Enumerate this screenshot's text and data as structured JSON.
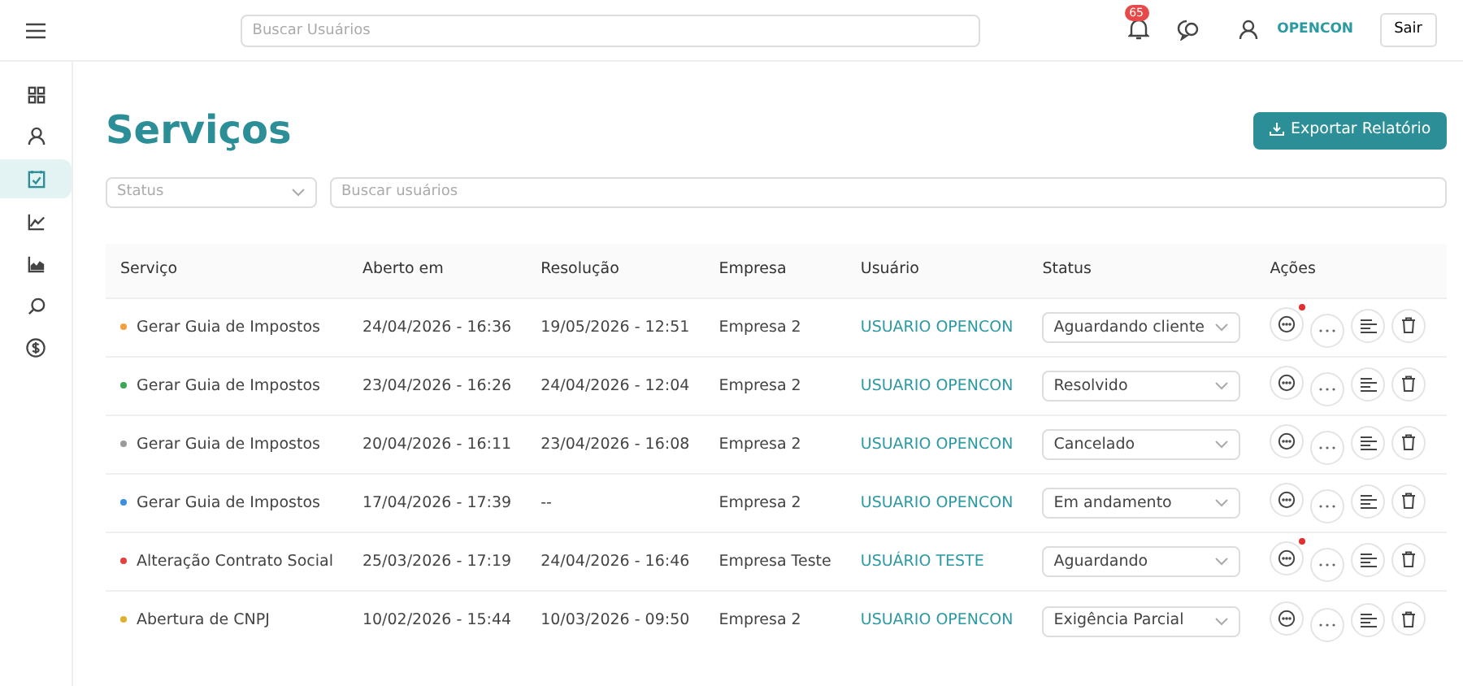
{
  "topbar": {
    "search": {
      "placeholder": "Buscar Usuários"
    },
    "notifications": {
      "count": "65"
    },
    "user": "OPENCON",
    "logout": "Sair"
  },
  "sidebar": {
    "items": [
      {
        "selected": false
      },
      {
        "selected": false
      },
      {
        "selected": true
      },
      {
        "selected": false
      },
      {
        "selected": false
      },
      {
        "selected": false
      },
      {
        "selected": false
      }
    ]
  },
  "page": {
    "title": "Serviços",
    "export_button": "Exportar Relatório"
  },
  "filters": {
    "status": {
      "placeholder": "Status"
    },
    "search": {
      "placeholder": "Buscar usuários"
    }
  },
  "table": {
    "columns": [
      "Serviço",
      "Aberto em",
      "Resolução",
      "Empresa",
      "Usuário",
      "Status",
      "Ações"
    ],
    "rows": [
      {
        "service": "Gerar Guia de Impostos",
        "color": "#f0a040",
        "opened": "24/04/2026 - 16:36",
        "resolution": "19/05/2026 - 12:51",
        "company": "Empresa 2",
        "user": "USUARIO OPENCON",
        "status": "Aguardando cliente",
        "unread": true
      },
      {
        "service": "Gerar Guia de Impostos",
        "color": "#3aa655",
        "opened": "23/04/2026 - 16:26",
        "resolution": "24/04/2026 - 12:04",
        "company": "Empresa 2",
        "user": "USUARIO OPENCON",
        "status": "Resolvido",
        "unread": false
      },
      {
        "service": "Gerar Guia de Impostos",
        "color": "#9a9a9a",
        "opened": "20/04/2026 - 16:11",
        "resolution": "23/04/2026 - 16:08",
        "company": "Empresa 2",
        "user": "USUARIO OPENCON",
        "status": "Cancelado",
        "unread": false
      },
      {
        "service": "Gerar Guia de Impostos",
        "color": "#3b8fe0",
        "opened": "17/04/2026 - 17:39",
        "resolution": "--",
        "company": "Empresa 2",
        "user": "USUARIO OPENCON",
        "status": "Em andamento",
        "unread": false
      },
      {
        "service": "Alteração Contrato Social",
        "color": "#e04040",
        "opened": "25/03/2026 - 17:19",
        "resolution": "24/04/2026 - 16:46",
        "company": "Empresa Teste",
        "user": "USUÁRIO TESTE",
        "status": "Aguardando",
        "unread": true
      },
      {
        "service": "Abertura de CNPJ",
        "color": "#e0b030",
        "opened": "10/02/2026 - 15:44",
        "resolution": "10/03/2026 - 09:50",
        "company": "Empresa 2",
        "user": "USUARIO OPENCON",
        "status": "Exigência Parcial",
        "unread": false
      }
    ]
  }
}
